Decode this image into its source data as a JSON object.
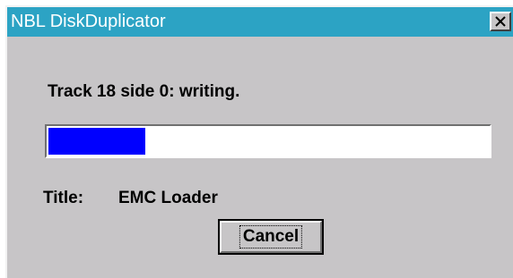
{
  "window": {
    "title": "NBL DiskDuplicator",
    "close_glyph": "✕"
  },
  "status": {
    "text": "Track 18 side 0: writing."
  },
  "progress": {
    "fraction": 0.22,
    "fill_color": "#0000ff"
  },
  "disk": {
    "label": "Title:",
    "value": "EMC Loader"
  },
  "buttons": {
    "cancel_label": "Cancel"
  },
  "colors": {
    "titlebar": "#2ca3c4",
    "window_bg": "#c7c5c7"
  },
  "icons": {
    "close": "close-icon"
  }
}
